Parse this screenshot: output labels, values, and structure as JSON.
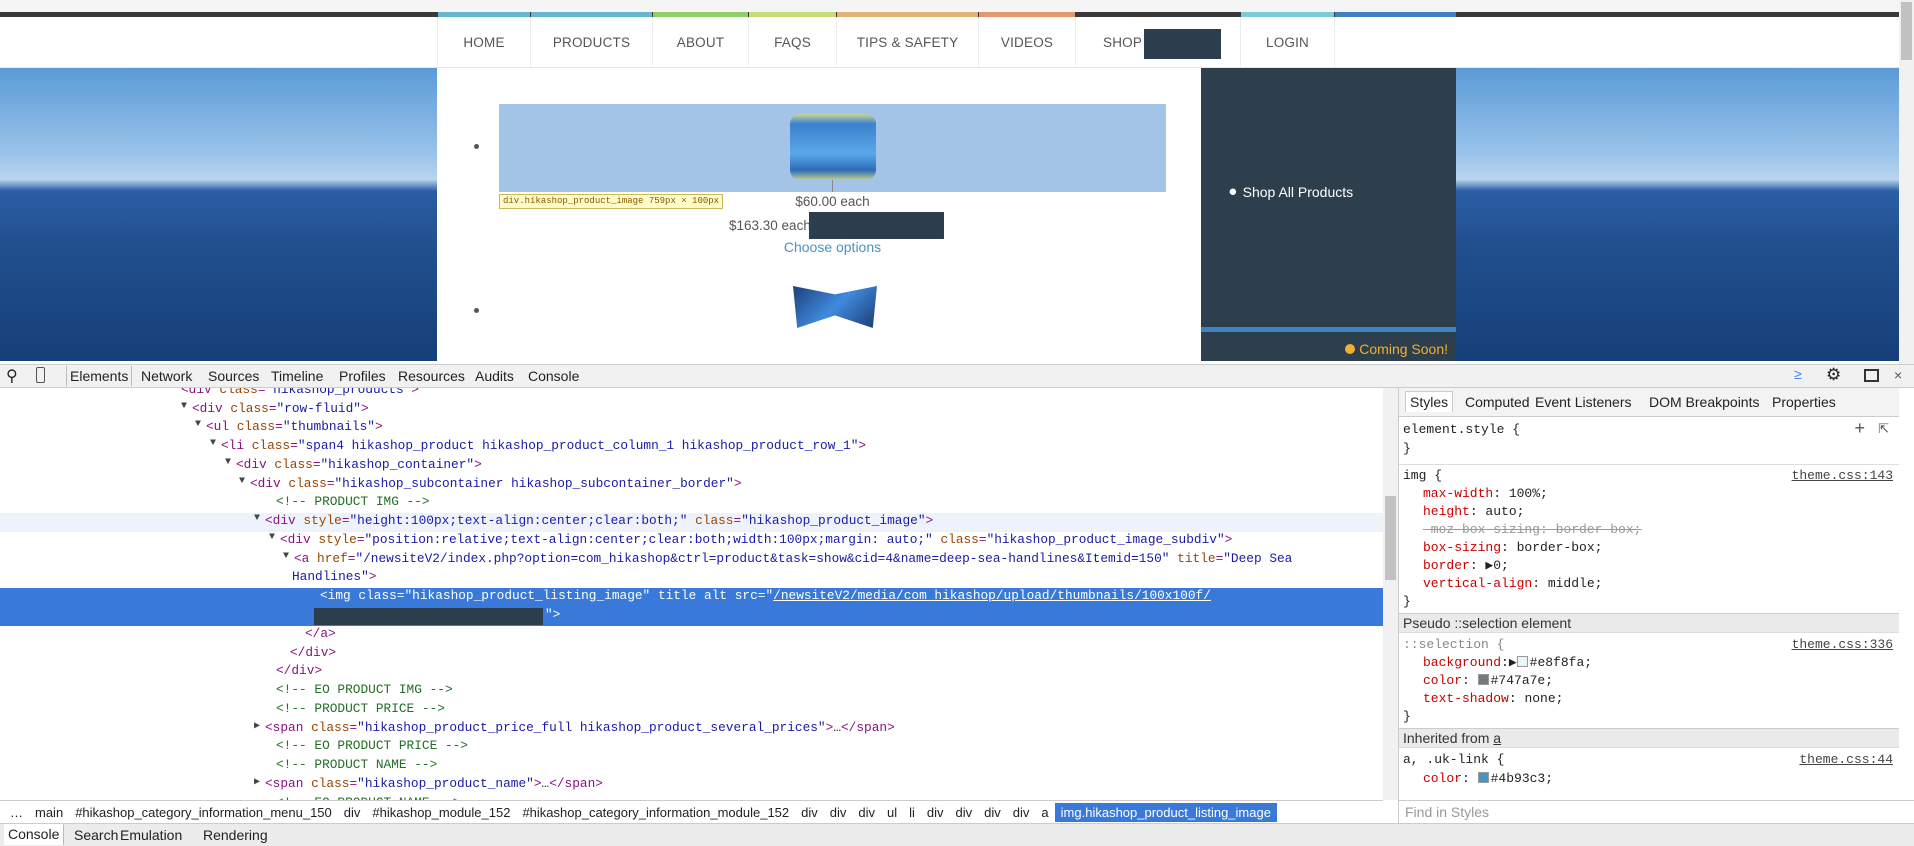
{
  "site": {
    "nav": [
      {
        "label": "HOME",
        "color": "#67b7d1"
      },
      {
        "label": "PRODUCTS",
        "color": "#67b7d1"
      },
      {
        "label": "ABOUT",
        "color": "#8fcf6a"
      },
      {
        "label": "FAQS",
        "color": "#c6dc7b"
      },
      {
        "label": "TIPS & SAFETY",
        "color": "#e3b274"
      },
      {
        "label": "VIDEOS",
        "color": "#e3996f"
      },
      {
        "label": "SHOP",
        "color": "#3a3a3a"
      },
      {
        "label": "LOGIN",
        "color": "#7ccbd7"
      },
      {
        "label": "",
        "color": "#3f80c2"
      }
    ],
    "tooltip": {
      "selector": "div.hikashop_product_image",
      "size": "759px × 100px"
    },
    "product": {
      "price1": "$60.00 each",
      "price2": "$163.30 each",
      "link": "Choose options"
    },
    "sidebar": {
      "shop_all": "Shop All Products",
      "coming_soon": "Coming Soon!"
    }
  },
  "devtools": {
    "tabs": [
      "Elements",
      "Network",
      "Sources",
      "Timeline",
      "Profiles",
      "Resources",
      "Audits",
      "Console"
    ],
    "active_tab": "Elements",
    "code_lines": [
      {
        "indent": 181,
        "tri": "",
        "segs": [
          [
            "tag",
            "<div "
          ],
          [
            "an",
            "class"
          ],
          [
            "tag",
            "="
          ],
          [
            "av",
            "\"hikashop_products\""
          ],
          [
            "tag",
            ">"
          ]
        ]
      },
      {
        "indent": 192,
        "tri": "▼",
        "segs": [
          [
            "tag",
            "<div "
          ],
          [
            "an",
            "class"
          ],
          [
            "tag",
            "="
          ],
          [
            "av",
            "\"row-fluid\""
          ],
          [
            "tag",
            ">"
          ]
        ]
      },
      {
        "indent": 206,
        "tri": "▼",
        "segs": [
          [
            "tag",
            "<ul "
          ],
          [
            "an",
            "class"
          ],
          [
            "tag",
            "="
          ],
          [
            "av",
            "\"thumbnails\""
          ],
          [
            "tag",
            ">"
          ]
        ]
      },
      {
        "indent": 221,
        "tri": "▼",
        "segs": [
          [
            "tag",
            "<li "
          ],
          [
            "an",
            "class"
          ],
          [
            "tag",
            "="
          ],
          [
            "av",
            "\"span4 hikashop_product hikashop_product_column_1 hikashop_product_row_1\""
          ],
          [
            "tag",
            ">"
          ]
        ]
      },
      {
        "indent": 236,
        "tri": "▼",
        "segs": [
          [
            "tag",
            "<div "
          ],
          [
            "an",
            "class"
          ],
          [
            "tag",
            "="
          ],
          [
            "av",
            "\"hikashop_container\""
          ],
          [
            "tag",
            ">"
          ]
        ]
      },
      {
        "indent": 250,
        "tri": "▼",
        "segs": [
          [
            "tag",
            "<div "
          ],
          [
            "an",
            "class"
          ],
          [
            "tag",
            "="
          ],
          [
            "av",
            "\"hikashop_subcontainer hikashop_subcontainer_border\""
          ],
          [
            "tag",
            ">"
          ]
        ]
      },
      {
        "indent": 276,
        "tri": "",
        "segs": [
          [
            "cm",
            "<!-- PRODUCT IMG -->"
          ]
        ]
      },
      {
        "indent": 265,
        "tri": "▼",
        "hover": true,
        "segs": [
          [
            "tag",
            "<div "
          ],
          [
            "an",
            "style"
          ],
          [
            "tag",
            "="
          ],
          [
            "av",
            "\"height:100px;text-align:center;clear:both;\""
          ],
          [
            "tag",
            " "
          ],
          [
            "an",
            "class"
          ],
          [
            "tag",
            "="
          ],
          [
            "av",
            "\"hikashop_product_image\""
          ],
          [
            "tag",
            ">"
          ]
        ]
      },
      {
        "indent": 280,
        "tri": "▼",
        "segs": [
          [
            "tag",
            "<div "
          ],
          [
            "an",
            "style"
          ],
          [
            "tag",
            "="
          ],
          [
            "av",
            "\"position:relative;text-align:center;clear:both;width:100px;margin: auto;\""
          ],
          [
            "tag",
            " "
          ],
          [
            "an",
            "class"
          ],
          [
            "tag",
            "="
          ],
          [
            "av",
            "\"hikashop_product_image_subdiv\""
          ],
          [
            "tag",
            ">"
          ]
        ]
      },
      {
        "indent": 294,
        "tri": "▼",
        "segs": [
          [
            "tag",
            "<a "
          ],
          [
            "an",
            "href"
          ],
          [
            "tag",
            "="
          ],
          [
            "av",
            "\"/newsiteV2/index.php?option=com_hikashop&ctrl=product&task=show&cid=4&name=deep-sea-handlines&Itemid=150\""
          ],
          [
            "tag",
            " "
          ],
          [
            "an",
            "title"
          ],
          [
            "tag",
            "="
          ],
          [
            "av",
            "\"Deep Sea"
          ]
        ]
      },
      {
        "indent": 292,
        "tri": "",
        "segs": [
          [
            "av",
            "Handlines\""
          ],
          [
            "tag",
            ">"
          ]
        ]
      },
      {
        "indent": 320,
        "tri": "",
        "sel": true,
        "segs": [
          [
            "tag",
            "<img "
          ],
          [
            "an",
            "class"
          ],
          [
            "tag",
            "="
          ],
          [
            "av",
            "\"hikashop_product_listing_image\""
          ],
          [
            "tag",
            " "
          ],
          [
            "an",
            "title alt src"
          ],
          [
            "tag",
            "="
          ],
          [
            "av",
            "\""
          ],
          [
            "lk",
            "/newsiteV2/media/com_hikashop/upload/thumbnails/100x100f/"
          ]
        ]
      },
      {
        "indent": 305,
        "tri": "",
        "segs": [
          [
            "tag",
            "</a>"
          ]
        ]
      },
      {
        "indent": 290,
        "tri": "",
        "segs": [
          [
            "tag",
            "</div>"
          ]
        ]
      },
      {
        "indent": 276,
        "tri": "",
        "segs": [
          [
            "tag",
            "</div>"
          ]
        ]
      },
      {
        "indent": 276,
        "tri": "",
        "segs": [
          [
            "cm",
            "<!-- EO PRODUCT IMG -->"
          ]
        ]
      },
      {
        "indent": 276,
        "tri": "",
        "segs": [
          [
            "cm",
            "<!-- PRODUCT PRICE -->"
          ]
        ]
      },
      {
        "indent": 265,
        "tri": "▶",
        "segs": [
          [
            "tag",
            "<span "
          ],
          [
            "an",
            "class"
          ],
          [
            "tag",
            "="
          ],
          [
            "av",
            "\"hikashop_product_price_full hikashop_product_several_prices\""
          ],
          [
            "tag",
            ">"
          ],
          [
            "tx",
            "…"
          ],
          [
            "tag",
            "</span>"
          ]
        ]
      },
      {
        "indent": 276,
        "tri": "",
        "segs": [
          [
            "cm",
            "<!-- EO PRODUCT PRICE -->"
          ]
        ]
      },
      {
        "indent": 276,
        "tri": "",
        "segs": [
          [
            "cm",
            "<!-- PRODUCT NAME -->"
          ]
        ]
      },
      {
        "indent": 265,
        "tri": "▶",
        "segs": [
          [
            "tag",
            "<span "
          ],
          [
            "an",
            "class"
          ],
          [
            "tag",
            "="
          ],
          [
            "av",
            "\"hikashop_product_name\""
          ],
          [
            "tag",
            ">"
          ],
          [
            "tx",
            "…"
          ],
          [
            "tag",
            "</span>"
          ]
        ]
      },
      {
        "indent": 276,
        "tri": "",
        "segs": [
          [
            "cm",
            "<!-- EO PRODUCT NAME -->"
          ]
        ]
      }
    ],
    "sel_tail": "\">",
    "breadcrumbs": [
      "…",
      "main",
      "#hikashop_category_information_menu_150",
      "div",
      "#hikashop_module_152",
      "#hikashop_category_information_module_152",
      "div",
      "div",
      "div",
      "ul",
      "li",
      "div",
      "div",
      "div",
      "div",
      "a",
      "img.hikashop_product_listing_image"
    ],
    "styles_tabs": [
      "Styles",
      "Computed",
      "Event Listeners",
      "DOM Breakpoints",
      "Properties"
    ],
    "element_style": "element.style {",
    "img_rule": {
      "selector": "img {",
      "source": "theme.css:143",
      "props": [
        [
          "max-width",
          "100%;"
        ],
        [
          "height",
          "auto;"
        ],
        [
          "-moz-box-sizing",
          "border-box;"
        ],
        [
          "box-sizing",
          "border-box;"
        ],
        [
          "border",
          "▶0;"
        ],
        [
          "vertical-align",
          "middle;"
        ]
      ]
    },
    "pseudo_header": "Pseudo ::selection element",
    "selection_rule": {
      "selector": "::selection {",
      "source": "theme.css:336",
      "background": "#e8f8fa",
      "color": "#747a7e",
      "text_shadow": "none;"
    },
    "inherited_header": "Inherited from",
    "inherited_from": "a",
    "link_rule": {
      "selector": "a, .uk-link {",
      "source": "theme.css:44",
      "color": "#4b93c3"
    },
    "find_placeholder": "Find in Styles",
    "drawer_tabs": [
      "Console",
      "Search",
      "Emulation",
      "Rendering"
    ]
  }
}
